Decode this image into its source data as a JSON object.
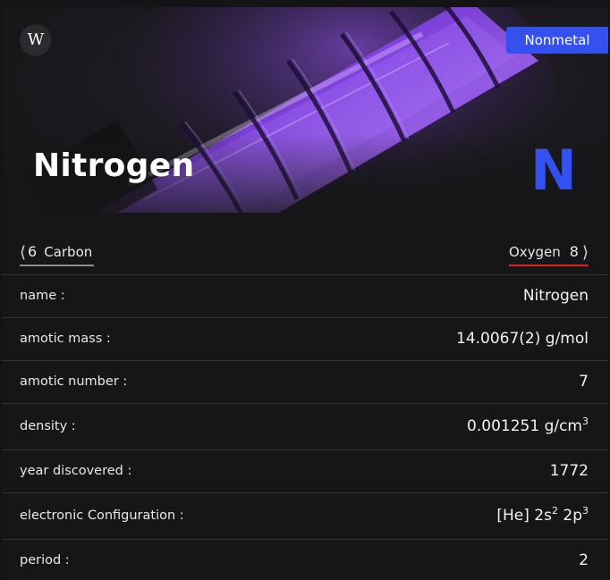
{
  "hero": {
    "wiki_icon_glyph": "W",
    "category": "Nonmetal",
    "name": "Nitrogen",
    "symbol": "N",
    "colors": {
      "accent_blue": "#3451ee",
      "glow_purple": "#8a3dff",
      "next_underline": "#e0231d"
    }
  },
  "nav": {
    "prev": {
      "number": "6",
      "name": "Carbon",
      "icon": "chevron-left-icon"
    },
    "next": {
      "number": "8",
      "name": "Oxygen",
      "icon": "chevron-right-icon"
    }
  },
  "properties": [
    {
      "label": "name :",
      "value": "Nitrogen"
    },
    {
      "label": "amotic mass :",
      "value": "14.0067(2) g/mol"
    },
    {
      "label": "amotic number :",
      "value": "7"
    },
    {
      "label": "density :",
      "value": "0.001251 g/cm",
      "sup": "3"
    },
    {
      "label": "year discovered :",
      "value": "1772"
    },
    {
      "label": "electronic Configuration :",
      "value_parts": [
        "[He] 2s",
        "2",
        " 2p",
        "3"
      ]
    },
    {
      "label": "period :",
      "value": "2"
    }
  ]
}
